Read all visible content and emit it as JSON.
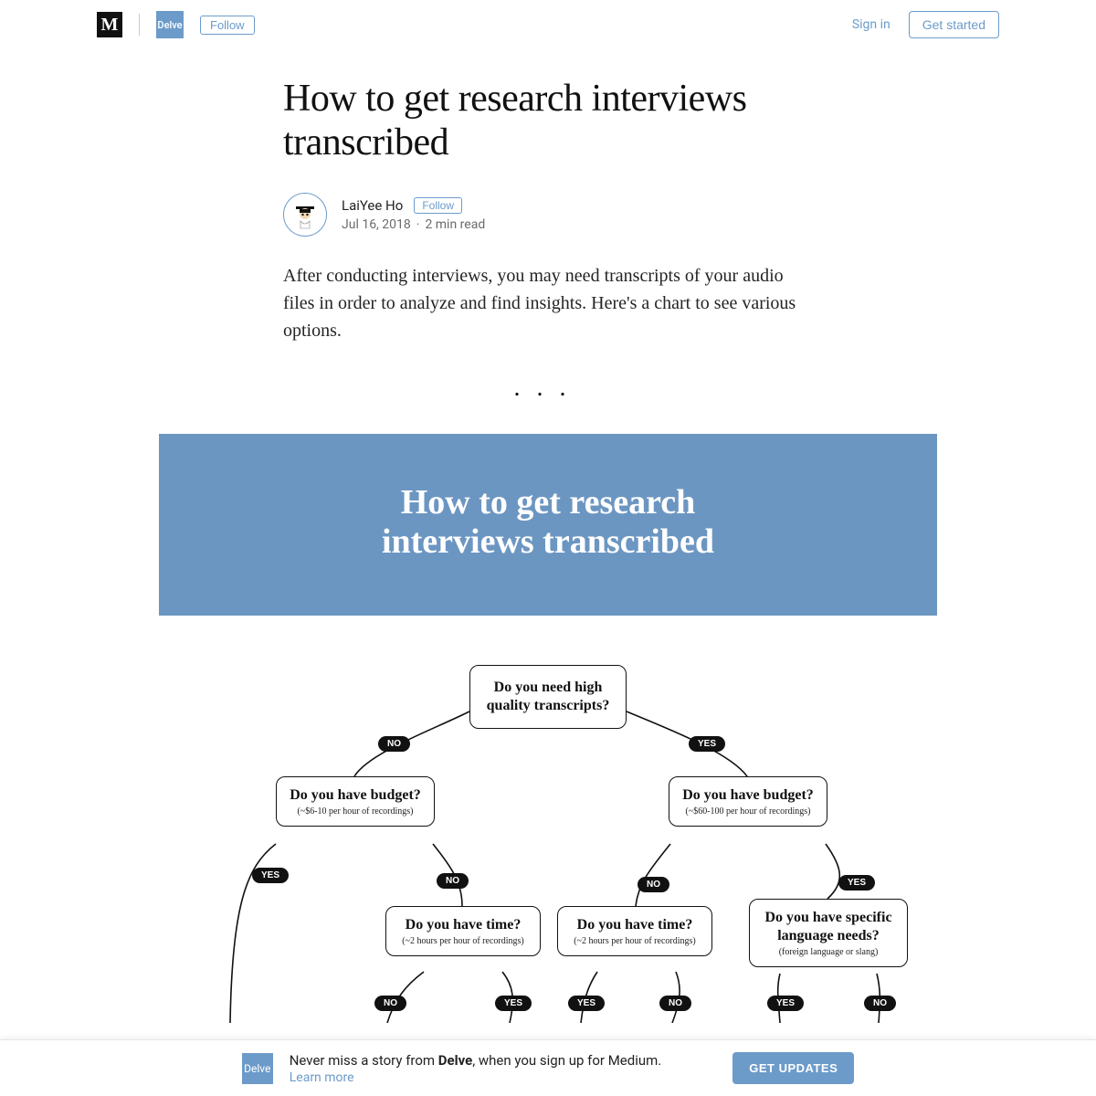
{
  "header": {
    "site_initial": "M",
    "publication_name": "Delve",
    "follow_label": "Follow",
    "signin_label": "Sign in",
    "getstarted_label": "Get started"
  },
  "article": {
    "title": "How to get research interviews transcribed",
    "author_name": "LaiYee Ho",
    "follow_author_label": "Follow",
    "date": "Jul 16, 2018",
    "read_time": "2 min read",
    "intro_paragraph": "After conducting interviews, you may need transcripts of your audio files in order to analyze and find insights. Here's a chart to see various options."
  },
  "figure": {
    "header_title_line1": "How to get research",
    "header_title_line2": "interviews transcribed",
    "root_question": "Do you need high quality transcripts?",
    "budget_left_question": "Do you have budget?",
    "budget_left_sub": "(~$6-10 per hour of recordings)",
    "budget_right_question": "Do you have budget?",
    "budget_right_sub": "(~$60-100 per hour of recordings)",
    "time_left_question": "Do you have time?",
    "time_left_sub": "(~2 hours per hour of recordings)",
    "time_mid_question": "Do you have time?",
    "time_mid_sub": "(~2 hours per hour of recordings)",
    "language_question": "Do you have specific language needs?",
    "language_sub": "(foreign language or slang)",
    "pill_yes": "YES",
    "pill_no": "NO"
  },
  "banner": {
    "logo_text": "Delve",
    "text_prefix": "Never miss a story from ",
    "publication_name": "Delve",
    "text_suffix": ", when you sign up for Medium.",
    "learn_more": "Learn more",
    "cta_label": "GET UPDATES"
  },
  "colors": {
    "accent": "#6c9bc9",
    "figure_header_bg": "#6c96c2"
  },
  "chart_data": {
    "type": "flowchart",
    "title": "How to get research interviews transcribed",
    "root": {
      "id": "q_quality",
      "text": "Do you need high quality transcripts?",
      "edges": [
        {
          "label": "NO",
          "to": "q_budget_low"
        },
        {
          "label": "YES",
          "to": "q_budget_high"
        }
      ]
    },
    "nodes": [
      {
        "id": "q_budget_low",
        "text": "Do you have budget?",
        "sub": "(~$6-10 per hour of recordings)",
        "edges": [
          {
            "label": "YES",
            "to": null
          },
          {
            "label": "NO",
            "to": "q_time_left"
          }
        ]
      },
      {
        "id": "q_budget_high",
        "text": "Do you have budget?",
        "sub": "(~$60-100 per hour of recordings)",
        "edges": [
          {
            "label": "NO",
            "to": "q_time_mid"
          },
          {
            "label": "YES",
            "to": "q_language"
          }
        ]
      },
      {
        "id": "q_time_left",
        "text": "Do you have time?",
        "sub": "(~2 hours per hour of recordings)",
        "edges": [
          {
            "label": "NO",
            "to": null
          },
          {
            "label": "YES",
            "to": null
          }
        ]
      },
      {
        "id": "q_time_mid",
        "text": "Do you have time?",
        "sub": "(~2 hours per hour of recordings)",
        "edges": [
          {
            "label": "YES",
            "to": null
          },
          {
            "label": "NO",
            "to": null
          }
        ]
      },
      {
        "id": "q_language",
        "text": "Do you have specific language needs?",
        "sub": "(foreign language or slang)",
        "edges": [
          {
            "label": "YES",
            "to": null
          },
          {
            "label": "NO",
            "to": null
          }
        ]
      }
    ]
  }
}
